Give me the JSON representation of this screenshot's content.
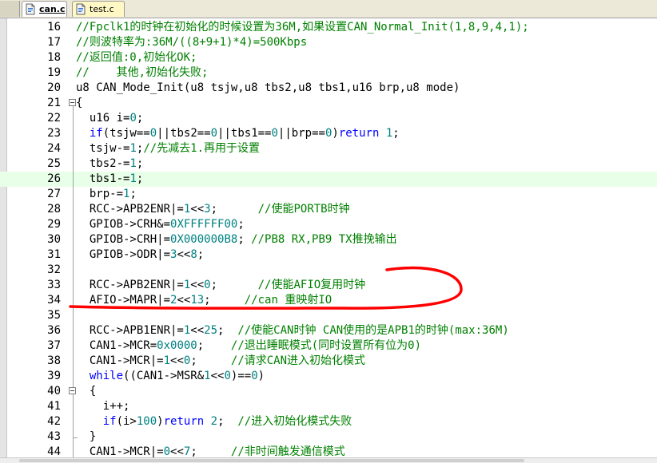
{
  "tabs": [
    {
      "label": "can.c",
      "active": true,
      "icon": "c-file-icon"
    },
    {
      "label": "test.c",
      "active": false,
      "icon": "c-file-icon"
    }
  ],
  "colors": {
    "comment": "#008000",
    "keyword": "#0000ff",
    "number": "#008080",
    "text": "#000000",
    "current_line": "#e8ffe8",
    "annotation_circle": "#ff0000"
  },
  "highlighted_line": "26",
  "lines": [
    {
      "num": "16",
      "parts": [
        {
          "t": "//Fpclk1的时钟在初始化的时候设置为36M,如果设置CAN_Normal_Init(1,8,9,4,1);",
          "c": "c"
        }
      ]
    },
    {
      "num": "17",
      "parts": [
        {
          "t": "//则波特率为:36M/((8+9+1)*4)=500Kbps",
          "c": "c"
        }
      ]
    },
    {
      "num": "18",
      "parts": [
        {
          "t": "//返回值:0,初始化OK;",
          "c": "c"
        }
      ]
    },
    {
      "num": "19",
      "parts": [
        {
          "t": "//    其他,初始化失败;",
          "c": "c"
        }
      ]
    },
    {
      "num": "20",
      "parts": [
        {
          "t": "u8 CAN_Mode_Init(u8 tsjw,u8 tbs2,u8 tbs1,u16 brp,u8 mode)",
          "c": ""
        }
      ]
    },
    {
      "num": "21",
      "fold": "open",
      "parts": [
        {
          "t": "{",
          "c": ""
        }
      ]
    },
    {
      "num": "22",
      "parts": [
        {
          "t": "  u16 i=",
          "c": ""
        },
        {
          "t": "0",
          "c": "n"
        },
        {
          "t": ";",
          "c": ""
        }
      ]
    },
    {
      "num": "23",
      "parts": [
        {
          "t": "  ",
          "c": ""
        },
        {
          "t": "if",
          "c": "k"
        },
        {
          "t": "(tsjw==",
          "c": ""
        },
        {
          "t": "0",
          "c": "n"
        },
        {
          "t": "||tbs2==",
          "c": ""
        },
        {
          "t": "0",
          "c": "n"
        },
        {
          "t": "||tbs1==",
          "c": ""
        },
        {
          "t": "0",
          "c": "n"
        },
        {
          "t": "||brp==",
          "c": ""
        },
        {
          "t": "0",
          "c": "n"
        },
        {
          "t": ")",
          "c": ""
        },
        {
          "t": "return",
          "c": "k"
        },
        {
          "t": " ",
          "c": ""
        },
        {
          "t": "1",
          "c": "n"
        },
        {
          "t": ";",
          "c": ""
        }
      ]
    },
    {
      "num": "24",
      "parts": [
        {
          "t": "  tsjw-=",
          "c": ""
        },
        {
          "t": "1",
          "c": "n"
        },
        {
          "t": ";",
          "c": ""
        },
        {
          "t": "//先减去1.再用于设置",
          "c": "c"
        }
      ]
    },
    {
      "num": "25",
      "parts": [
        {
          "t": "  tbs2-=",
          "c": ""
        },
        {
          "t": "1",
          "c": "n"
        },
        {
          "t": ";",
          "c": ""
        }
      ]
    },
    {
      "num": "26",
      "parts": [
        {
          "t": "  tbs1-=",
          "c": ""
        },
        {
          "t": "1",
          "c": "n"
        },
        {
          "t": ";",
          "c": ""
        }
      ]
    },
    {
      "num": "27",
      "parts": [
        {
          "t": "  brp-=",
          "c": ""
        },
        {
          "t": "1",
          "c": "n"
        },
        {
          "t": ";",
          "c": ""
        }
      ]
    },
    {
      "num": "28",
      "parts": [
        {
          "t": "  RCC->APB2ENR|=",
          "c": ""
        },
        {
          "t": "1",
          "c": "n"
        },
        {
          "t": "<<",
          "c": ""
        },
        {
          "t": "3",
          "c": "n"
        },
        {
          "t": ";      ",
          "c": ""
        },
        {
          "t": "//使能PORTB时钟",
          "c": "c"
        }
      ]
    },
    {
      "num": "29",
      "parts": [
        {
          "t": "  GPIOB->CRH&=",
          "c": ""
        },
        {
          "t": "0XFFFFFF00",
          "c": "n"
        },
        {
          "t": ";",
          "c": ""
        }
      ]
    },
    {
      "num": "30",
      "parts": [
        {
          "t": "  GPIOB->CRH|=",
          "c": ""
        },
        {
          "t": "0X000000B8",
          "c": "n"
        },
        {
          "t": "; ",
          "c": ""
        },
        {
          "t": "//PB8 RX,PB9 TX推挽输出",
          "c": "c"
        }
      ]
    },
    {
      "num": "31",
      "parts": [
        {
          "t": "  GPIOB->ODR|=",
          "c": ""
        },
        {
          "t": "3",
          "c": "n"
        },
        {
          "t": "<<",
          "c": ""
        },
        {
          "t": "8",
          "c": "n"
        },
        {
          "t": ";",
          "c": ""
        }
      ]
    },
    {
      "num": "32",
      "parts": []
    },
    {
      "num": "33",
      "parts": [
        {
          "t": "  RCC->APB2ENR|=",
          "c": ""
        },
        {
          "t": "1",
          "c": "n"
        },
        {
          "t": "<<",
          "c": ""
        },
        {
          "t": "0",
          "c": "n"
        },
        {
          "t": ";      ",
          "c": ""
        },
        {
          "t": "//使能AFIO复用时钟",
          "c": "c"
        }
      ]
    },
    {
      "num": "34",
      "parts": [
        {
          "t": "  AFIO->MAPR|=",
          "c": ""
        },
        {
          "t": "2",
          "c": "n"
        },
        {
          "t": "<<",
          "c": ""
        },
        {
          "t": "13",
          "c": "n"
        },
        {
          "t": ";     ",
          "c": ""
        },
        {
          "t": "//can 重映射IO",
          "c": "c"
        }
      ]
    },
    {
      "num": "35",
      "parts": []
    },
    {
      "num": "36",
      "parts": [
        {
          "t": "  RCC->APB1ENR|=",
          "c": ""
        },
        {
          "t": "1",
          "c": "n"
        },
        {
          "t": "<<",
          "c": ""
        },
        {
          "t": "25",
          "c": "n"
        },
        {
          "t": ";  ",
          "c": ""
        },
        {
          "t": "//使能CAN时钟 CAN使用的是APB1的时钟(max:36M)",
          "c": "c"
        }
      ]
    },
    {
      "num": "37",
      "parts": [
        {
          "t": "  CAN1->MCR=",
          "c": ""
        },
        {
          "t": "0x0000",
          "c": "n"
        },
        {
          "t": ";    ",
          "c": ""
        },
        {
          "t": "//退出睡眠模式(同时设置所有位为0)",
          "c": "c"
        }
      ]
    },
    {
      "num": "38",
      "parts": [
        {
          "t": "  CAN1->MCR|=",
          "c": ""
        },
        {
          "t": "1",
          "c": "n"
        },
        {
          "t": "<<",
          "c": ""
        },
        {
          "t": "0",
          "c": "n"
        },
        {
          "t": ";     ",
          "c": ""
        },
        {
          "t": "//请求CAN进入初始化模式",
          "c": "c"
        }
      ]
    },
    {
      "num": "39",
      "parts": [
        {
          "t": "  ",
          "c": ""
        },
        {
          "t": "while",
          "c": "k"
        },
        {
          "t": "((CAN1->MSR&",
          "c": ""
        },
        {
          "t": "1",
          "c": "n"
        },
        {
          "t": "<<",
          "c": ""
        },
        {
          "t": "0",
          "c": "n"
        },
        {
          "t": ")==",
          "c": ""
        },
        {
          "t": "0",
          "c": "n"
        },
        {
          "t": ")",
          "c": ""
        }
      ]
    },
    {
      "num": "40",
      "fold": "open",
      "parts": [
        {
          "t": "  {",
          "c": ""
        }
      ]
    },
    {
      "num": "41",
      "parts": [
        {
          "t": "    i++;",
          "c": ""
        }
      ]
    },
    {
      "num": "42",
      "parts": [
        {
          "t": "    ",
          "c": ""
        },
        {
          "t": "if",
          "c": "k"
        },
        {
          "t": "(i>",
          "c": ""
        },
        {
          "t": "100",
          "c": "n"
        },
        {
          "t": ")",
          "c": ""
        },
        {
          "t": "return",
          "c": "k"
        },
        {
          "t": " ",
          "c": ""
        },
        {
          "t": "2",
          "c": "n"
        },
        {
          "t": ";  ",
          "c": ""
        },
        {
          "t": "//进入初始化模式失败",
          "c": "c"
        }
      ]
    },
    {
      "num": "43",
      "fold": "end",
      "parts": [
        {
          "t": "  }",
          "c": ""
        }
      ]
    },
    {
      "num": "44",
      "parts": [
        {
          "t": "  CAN1->MCR|=",
          "c": ""
        },
        {
          "t": "0",
          "c": "n"
        },
        {
          "t": "<<",
          "c": ""
        },
        {
          "t": "7",
          "c": "n"
        },
        {
          "t": ";     ",
          "c": ""
        },
        {
          "t": "//非时间触发通信模式",
          "c": "c"
        }
      ]
    }
  ]
}
